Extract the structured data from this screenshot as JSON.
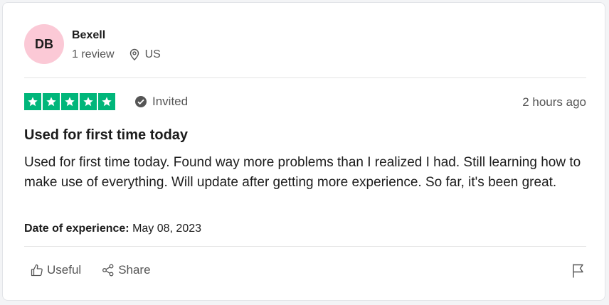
{
  "reviewer": {
    "initials": "DB",
    "name": "Bexell",
    "review_count": "1 review",
    "country": "US"
  },
  "rating": {
    "stars": 5,
    "max_stars": 5,
    "badge": "Invited",
    "time_ago": "2 hours ago"
  },
  "review": {
    "title": "Used for first time today",
    "body": "Used for first time today. Found way more problems than I realized I had. Still learning how to make use of everything. Will update after getting more experience. So far, it's been great.",
    "date_label": "Date of experience:",
    "date_value": "May 08, 2023"
  },
  "actions": {
    "useful_label": "Useful",
    "share_label": "Share"
  },
  "colors": {
    "star_green": "#00b67a",
    "avatar_pink": "#fbc9d6"
  },
  "icons": [
    "location-pin-icon",
    "star-icon",
    "check-circle-icon",
    "thumbs-up-icon",
    "share-icon",
    "flag-icon"
  ]
}
